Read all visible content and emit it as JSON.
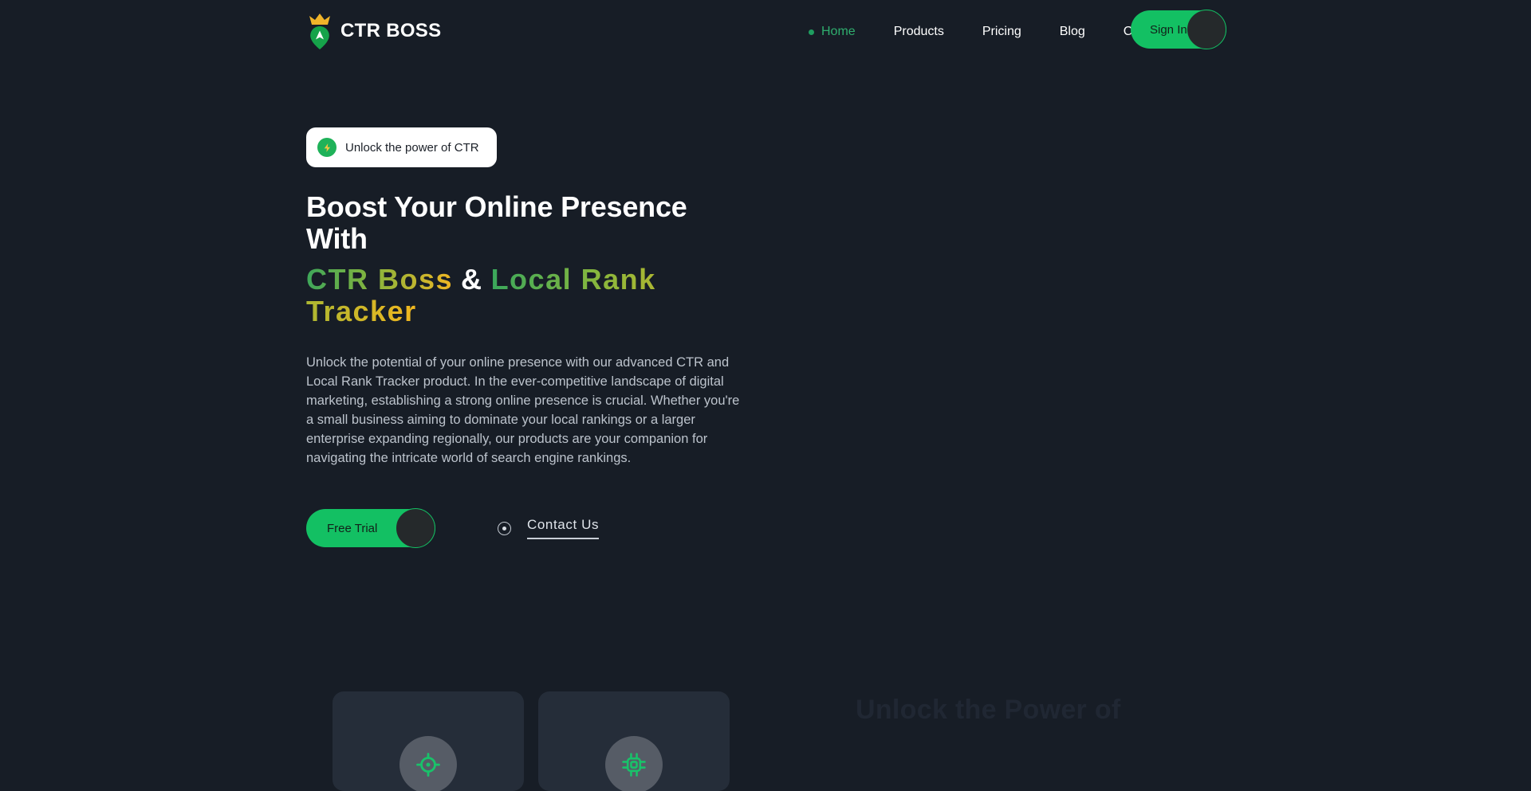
{
  "header": {
    "brand": {
      "name": "CTR BOSS",
      "logo_icon": "crown-map-pin-icon"
    },
    "nav": [
      {
        "label": "Home",
        "active": true
      },
      {
        "label": "Products",
        "active": false
      },
      {
        "label": "Pricing",
        "active": false
      },
      {
        "label": "Blog",
        "active": false
      },
      {
        "label": "Contact",
        "active": false
      }
    ],
    "sign_in_label": "Sign In"
  },
  "hero": {
    "badge": {
      "text": "Unlock the power of CTR",
      "icon": "lightning-bolt-icon"
    },
    "headline_line1": "Boost Your Online Presence With",
    "headline_part_ctr": "CTR Boss",
    "headline_amp": "&",
    "headline_part_lrt": "Local Rank Tracker",
    "paragraph": "Unlock the potential of your online presence with our advanced CTR and Local Rank Tracker product. In the ever-competitive landscape of digital marketing, establishing a strong online presence is crucial. Whether you're a small business aiming to dominate your local rankings or a larger enterprise expanding regionally, our products are your companion for navigating the intricate world of search engine rankings.",
    "primary_cta": "Free Trial",
    "secondary_cta": "Contact Us"
  },
  "section": {
    "ghost_title": "Unlock the Power of",
    "cards": [
      {
        "icon": "crosshair-target-icon"
      },
      {
        "icon": "cpu-chip-icon"
      }
    ]
  },
  "colors": {
    "page_background": "#171d26",
    "accent_green": "#13c063",
    "icon_green": "#19c26a",
    "gold": "#f2b71e",
    "card_background": "#252d39",
    "text_muted": "#bcc3cc",
    "ghost_text": "#202733"
  }
}
